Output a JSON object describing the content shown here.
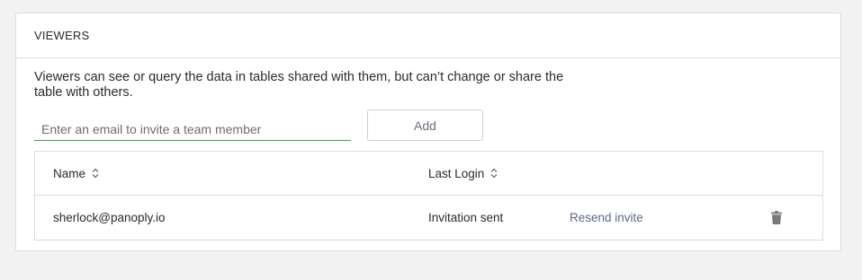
{
  "section": {
    "title": "VIEWERS",
    "description": "Viewers can see or query the data in tables shared with them, but can’t change or share the table with others."
  },
  "invite": {
    "placeholder": "Enter an email to invite a team member",
    "value": "",
    "add_label": "Add"
  },
  "table": {
    "columns": [
      {
        "label": "Name",
        "icon": "sort-icon"
      },
      {
        "label": "Last Login",
        "icon": "sort-icon"
      }
    ],
    "rows": [
      {
        "email": "sherlock@panoply.io",
        "status": "Invitation sent",
        "action": "Resend invite",
        "delete_icon": "trash-icon"
      }
    ]
  },
  "colors": {
    "input_underline": "#3aa35b",
    "link": "#5b6a86",
    "border": "#dcdcdc",
    "background": "#f2f2f2"
  }
}
